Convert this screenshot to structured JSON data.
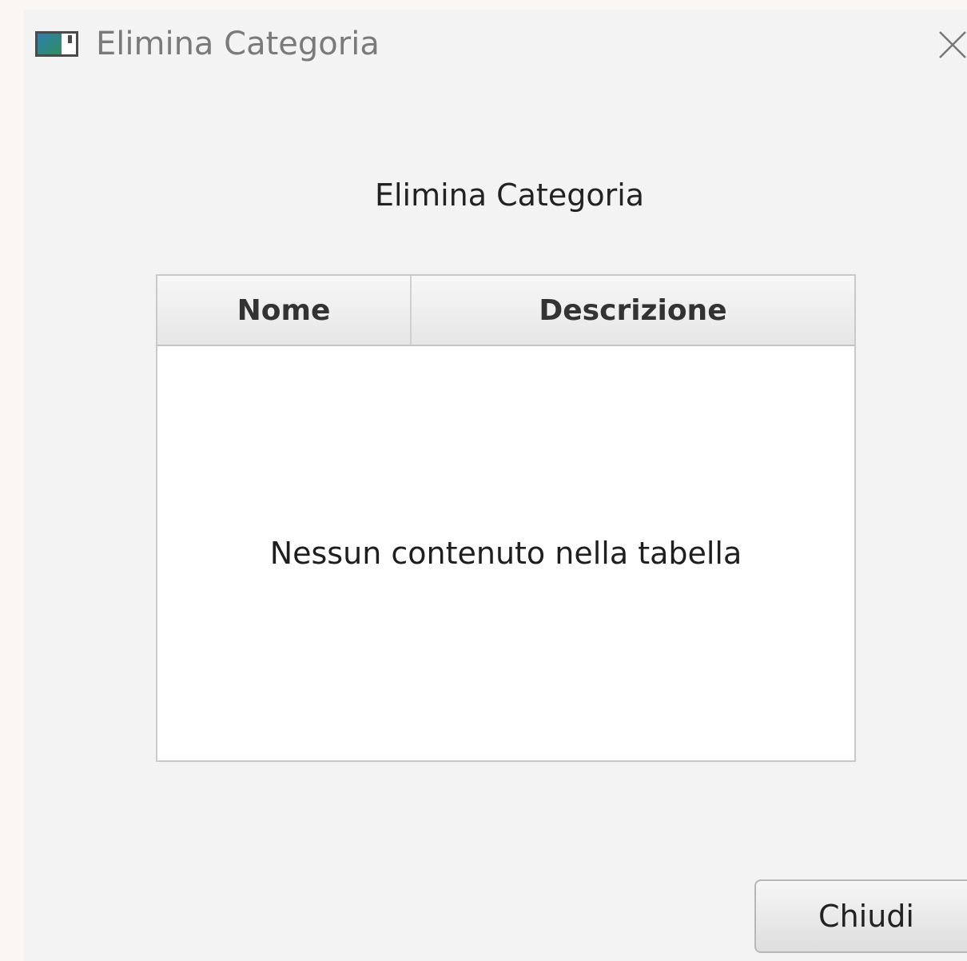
{
  "window": {
    "title": "Elimina Categoria",
    "icon": "app-window-icon",
    "close_icon": "close-icon"
  },
  "dialog": {
    "heading": "Elimina Categoria"
  },
  "table": {
    "columns": [
      "Nome",
      "Descrizione"
    ],
    "rows": [],
    "placeholder": "Nessun contenuto nella tabella"
  },
  "buttons": {
    "close_label": "Chiudi"
  },
  "colors": {
    "window_background": "#f3f3f3",
    "outer_background": "#faf6f3",
    "table_background": "#ffffff",
    "header_gradient_top": "#f7f7f7",
    "header_gradient_bottom": "#e6e6e6",
    "border": "#c9c9c9",
    "text": "#222222",
    "title_text": "#7a7a7a"
  }
}
